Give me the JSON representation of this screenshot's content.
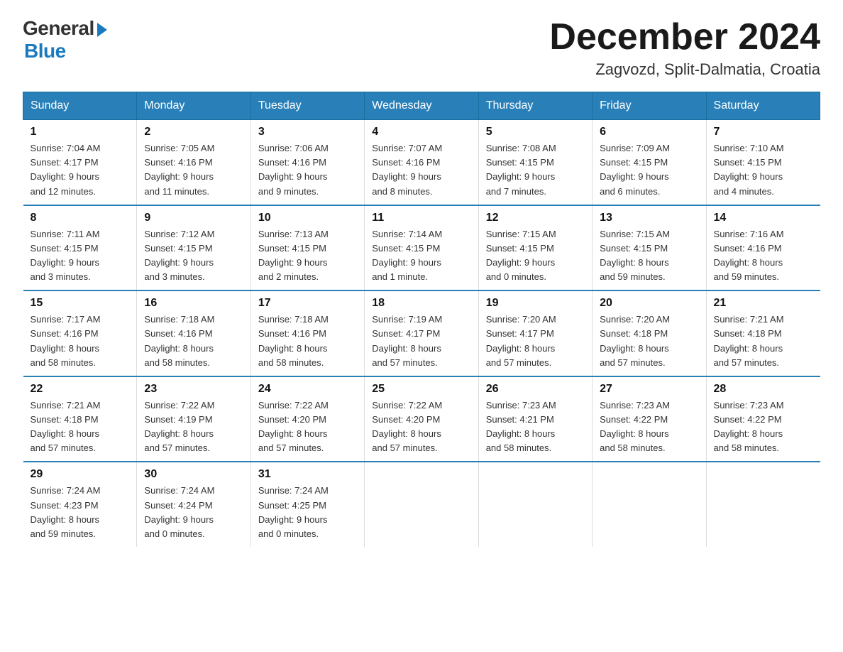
{
  "header": {
    "logo_general": "General",
    "logo_blue": "Blue",
    "title": "December 2024",
    "subtitle": "Zagvozd, Split-Dalmatia, Croatia"
  },
  "weekdays": [
    "Sunday",
    "Monday",
    "Tuesday",
    "Wednesday",
    "Thursday",
    "Friday",
    "Saturday"
  ],
  "weeks": [
    [
      {
        "day": "1",
        "info": "Sunrise: 7:04 AM\nSunset: 4:17 PM\nDaylight: 9 hours\nand 12 minutes."
      },
      {
        "day": "2",
        "info": "Sunrise: 7:05 AM\nSunset: 4:16 PM\nDaylight: 9 hours\nand 11 minutes."
      },
      {
        "day": "3",
        "info": "Sunrise: 7:06 AM\nSunset: 4:16 PM\nDaylight: 9 hours\nand 9 minutes."
      },
      {
        "day": "4",
        "info": "Sunrise: 7:07 AM\nSunset: 4:16 PM\nDaylight: 9 hours\nand 8 minutes."
      },
      {
        "day": "5",
        "info": "Sunrise: 7:08 AM\nSunset: 4:15 PM\nDaylight: 9 hours\nand 7 minutes."
      },
      {
        "day": "6",
        "info": "Sunrise: 7:09 AM\nSunset: 4:15 PM\nDaylight: 9 hours\nand 6 minutes."
      },
      {
        "day": "7",
        "info": "Sunrise: 7:10 AM\nSunset: 4:15 PM\nDaylight: 9 hours\nand 4 minutes."
      }
    ],
    [
      {
        "day": "8",
        "info": "Sunrise: 7:11 AM\nSunset: 4:15 PM\nDaylight: 9 hours\nand 3 minutes."
      },
      {
        "day": "9",
        "info": "Sunrise: 7:12 AM\nSunset: 4:15 PM\nDaylight: 9 hours\nand 3 minutes."
      },
      {
        "day": "10",
        "info": "Sunrise: 7:13 AM\nSunset: 4:15 PM\nDaylight: 9 hours\nand 2 minutes."
      },
      {
        "day": "11",
        "info": "Sunrise: 7:14 AM\nSunset: 4:15 PM\nDaylight: 9 hours\nand 1 minute."
      },
      {
        "day": "12",
        "info": "Sunrise: 7:15 AM\nSunset: 4:15 PM\nDaylight: 9 hours\nand 0 minutes."
      },
      {
        "day": "13",
        "info": "Sunrise: 7:15 AM\nSunset: 4:15 PM\nDaylight: 8 hours\nand 59 minutes."
      },
      {
        "day": "14",
        "info": "Sunrise: 7:16 AM\nSunset: 4:16 PM\nDaylight: 8 hours\nand 59 minutes."
      }
    ],
    [
      {
        "day": "15",
        "info": "Sunrise: 7:17 AM\nSunset: 4:16 PM\nDaylight: 8 hours\nand 58 minutes."
      },
      {
        "day": "16",
        "info": "Sunrise: 7:18 AM\nSunset: 4:16 PM\nDaylight: 8 hours\nand 58 minutes."
      },
      {
        "day": "17",
        "info": "Sunrise: 7:18 AM\nSunset: 4:16 PM\nDaylight: 8 hours\nand 58 minutes."
      },
      {
        "day": "18",
        "info": "Sunrise: 7:19 AM\nSunset: 4:17 PM\nDaylight: 8 hours\nand 57 minutes."
      },
      {
        "day": "19",
        "info": "Sunrise: 7:20 AM\nSunset: 4:17 PM\nDaylight: 8 hours\nand 57 minutes."
      },
      {
        "day": "20",
        "info": "Sunrise: 7:20 AM\nSunset: 4:18 PM\nDaylight: 8 hours\nand 57 minutes."
      },
      {
        "day": "21",
        "info": "Sunrise: 7:21 AM\nSunset: 4:18 PM\nDaylight: 8 hours\nand 57 minutes."
      }
    ],
    [
      {
        "day": "22",
        "info": "Sunrise: 7:21 AM\nSunset: 4:18 PM\nDaylight: 8 hours\nand 57 minutes."
      },
      {
        "day": "23",
        "info": "Sunrise: 7:22 AM\nSunset: 4:19 PM\nDaylight: 8 hours\nand 57 minutes."
      },
      {
        "day": "24",
        "info": "Sunrise: 7:22 AM\nSunset: 4:20 PM\nDaylight: 8 hours\nand 57 minutes."
      },
      {
        "day": "25",
        "info": "Sunrise: 7:22 AM\nSunset: 4:20 PM\nDaylight: 8 hours\nand 57 minutes."
      },
      {
        "day": "26",
        "info": "Sunrise: 7:23 AM\nSunset: 4:21 PM\nDaylight: 8 hours\nand 58 minutes."
      },
      {
        "day": "27",
        "info": "Sunrise: 7:23 AM\nSunset: 4:22 PM\nDaylight: 8 hours\nand 58 minutes."
      },
      {
        "day": "28",
        "info": "Sunrise: 7:23 AM\nSunset: 4:22 PM\nDaylight: 8 hours\nand 58 minutes."
      }
    ],
    [
      {
        "day": "29",
        "info": "Sunrise: 7:24 AM\nSunset: 4:23 PM\nDaylight: 8 hours\nand 59 minutes."
      },
      {
        "day": "30",
        "info": "Sunrise: 7:24 AM\nSunset: 4:24 PM\nDaylight: 9 hours\nand 0 minutes."
      },
      {
        "day": "31",
        "info": "Sunrise: 7:24 AM\nSunset: 4:25 PM\nDaylight: 9 hours\nand 0 minutes."
      },
      {
        "day": "",
        "info": ""
      },
      {
        "day": "",
        "info": ""
      },
      {
        "day": "",
        "info": ""
      },
      {
        "day": "",
        "info": ""
      }
    ]
  ]
}
